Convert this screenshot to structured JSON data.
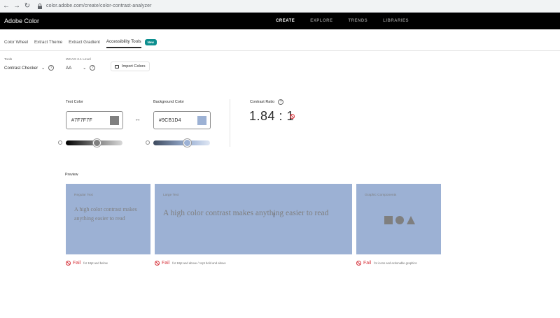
{
  "browser": {
    "url": "color.adobe.com/create/color-contrast-analyzer"
  },
  "header": {
    "brand": "Adobe Color",
    "nav": [
      "CREATE",
      "EXPLORE",
      "TRENDS",
      "LIBRARIES"
    ]
  },
  "tabs": [
    {
      "label": "Color Wheel"
    },
    {
      "label": "Extract Theme"
    },
    {
      "label": "Extract Gradient"
    },
    {
      "label": "Accessibility Tools",
      "badge": "New"
    }
  ],
  "controls": {
    "tools_label": "Tools",
    "tools_value": "Contrast Checker",
    "wcag_label": "WCAG 2.1 Level",
    "wcag_value": "AA",
    "import_label": "Import Colors"
  },
  "text_color": {
    "label": "Text Color",
    "hex": "#7F7F7F",
    "slider_level": 0.55
  },
  "background_color": {
    "label": "Background Color",
    "hex": "#9CB1D4",
    "slider_level": 0.6
  },
  "contrast": {
    "label": "Contrast Ratio",
    "value": "1.84 : 1"
  },
  "preview": {
    "label": "Preview",
    "cards": [
      {
        "title": "Regular Text",
        "text": "A high color contrast makes anything easier to read",
        "result": "Fail",
        "note": "for 18pt and below"
      },
      {
        "title": "Large Text",
        "text": "A high color contrast makes anything easier to read",
        "result": "Fail",
        "note": "for 18pt and above / 14pt bold and above"
      },
      {
        "title": "Graphic Components",
        "result": "Fail",
        "note": "for icons and actionable graphics"
      }
    ]
  },
  "colors": {
    "text": "#7F7F7F",
    "background": "#9CB1D4",
    "fail": "#d7373f",
    "badge": "#0d8f8f"
  }
}
